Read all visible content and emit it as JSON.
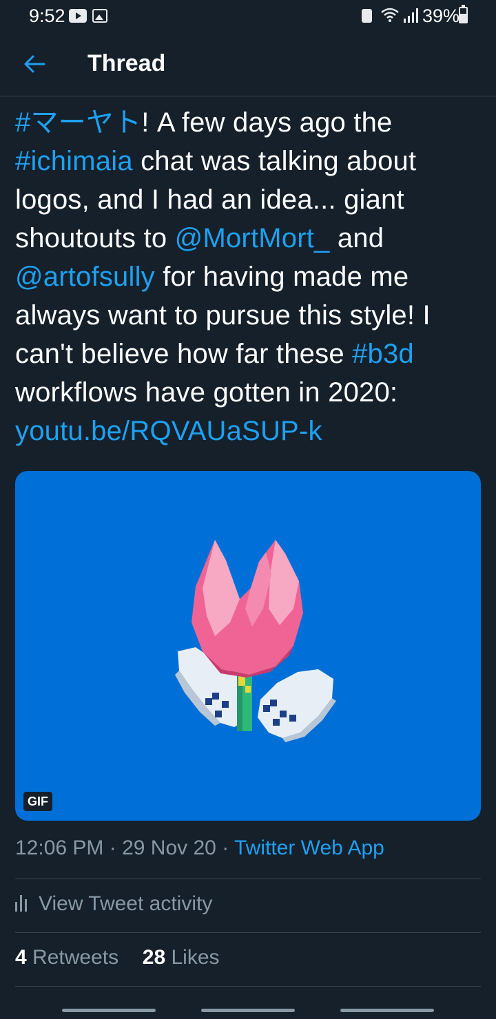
{
  "status_bar": {
    "time": "9:52",
    "battery": "39%",
    "icons": [
      "youtube-notification-icon",
      "image-notification-icon",
      "lock-icon",
      "wifi-icon",
      "signal-icon",
      "battery-icon"
    ]
  },
  "header": {
    "title": "Thread",
    "back_icon": "arrow-left-icon"
  },
  "tweet": {
    "text_segments": [
      {
        "t": "#マーヤト",
        "link": true
      },
      {
        "t": "! A few days ago the ",
        "link": false
      },
      {
        "t": "#ichimaia",
        "link": true
      },
      {
        "t": " chat was talking about logos, and I had an idea... giant shoutouts to ",
        "link": false
      },
      {
        "t": "@MortMort_",
        "link": true
      },
      {
        "t": " and ",
        "link": false
      },
      {
        "t": "@artofsully",
        "link": true
      },
      {
        "t": " for having made me always want to pursue this style! I can't believe how far these ",
        "link": false
      },
      {
        "t": "#b3d",
        "link": true
      },
      {
        "t": " workflows have gotten in 2020: ",
        "link": false
      },
      {
        "t": "youtu.be/RQVAUaSUP-k",
        "link": true
      }
    ],
    "media": {
      "badge": "GIF",
      "background_color": "#0070d8"
    },
    "time": "12:06 PM",
    "separator": " · ",
    "date": "29 Nov 20",
    "source": "Twitter Web App",
    "activity_label": "View Tweet activity",
    "retweets_count": "4",
    "retweets_label": "Retweets",
    "likes_count": "28",
    "likes_label": "Likes"
  },
  "colors": {
    "background": "#15202b",
    "accent": "#1da1f2",
    "secondary_text": "#8899a6",
    "divider": "#38444d"
  }
}
